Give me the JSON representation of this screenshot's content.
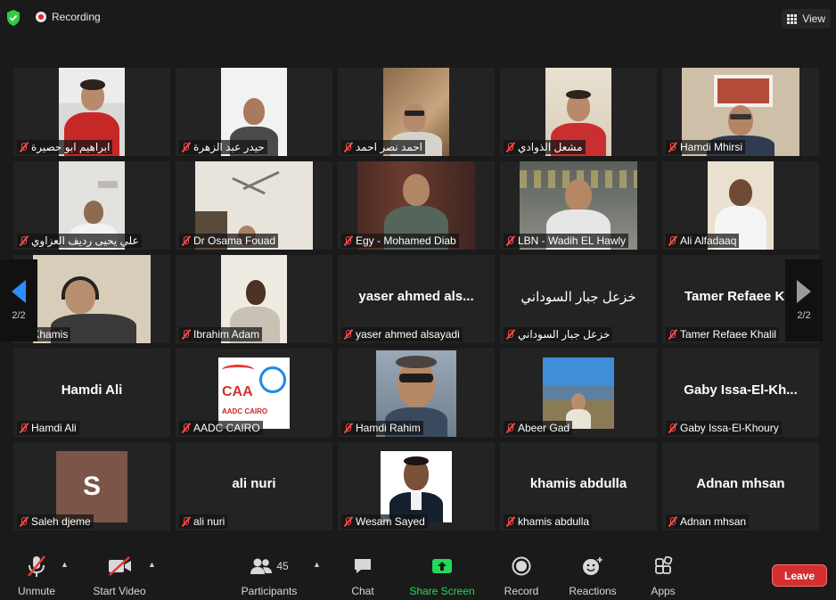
{
  "topbar": {
    "recording_label": "Recording",
    "view_label": "View"
  },
  "pagination": {
    "left_page": "2/2",
    "right_page": "2/2"
  },
  "tiles": [
    {
      "name": "ابراهيم ابو حصيرة",
      "big_name": "",
      "video": true
    },
    {
      "name": "حيدر عبد الزهرة",
      "big_name": "",
      "video": true
    },
    {
      "name": "احمد نصر احمد",
      "big_name": "",
      "video": true
    },
    {
      "name": "مشعل الذوادي",
      "big_name": "",
      "video": true
    },
    {
      "name": "Hamdi Mhirsi",
      "big_name": "",
      "video": true
    },
    {
      "name": "علي يحيى رديف العزاوي",
      "big_name": "",
      "video": true
    },
    {
      "name": "Dr Osama Fouad",
      "big_name": "",
      "video": true
    },
    {
      "name": "Egy - Mohamed Diab",
      "big_name": "",
      "video": true
    },
    {
      "name": "LBN - Wadih EL Hawly",
      "big_name": "",
      "video": true
    },
    {
      "name": "Ali Alfadaaq",
      "big_name": "",
      "video": true
    },
    {
      "name": "fic Khamis",
      "big_name": "",
      "video": true
    },
    {
      "name": "Ibrahim Adam",
      "big_name": "",
      "video": true
    },
    {
      "name": "yaser ahmed alsayadi",
      "big_name": "yaser ahmed als...",
      "video": false
    },
    {
      "name": "خزعل جبار السوداني",
      "big_name": "خزعل جبار السوداني",
      "video": false
    },
    {
      "name": "Tamer Refaee Khalil",
      "big_name": "Tamer Refaee K",
      "video": false
    },
    {
      "name": "Hamdi Ali",
      "big_name": "Hamdi Ali",
      "video": false
    },
    {
      "name": "AADC CAIRO",
      "big_name": "",
      "video": true
    },
    {
      "name": "Hamdi Rahim",
      "big_name": "",
      "video": true
    },
    {
      "name": "Abeer Gad",
      "big_name": "",
      "video": true
    },
    {
      "name": "Gaby Issa-El-Khoury",
      "big_name": "Gaby Issa-El-Kh...",
      "video": false
    },
    {
      "name": "Saleh djeme",
      "big_name": "",
      "video": true
    },
    {
      "name": "ali nuri",
      "big_name": "ali nuri",
      "video": false
    },
    {
      "name": "Wesam Sayed",
      "big_name": "",
      "video": true
    },
    {
      "name": "khamis abdulla",
      "big_name": "khamis abdulla",
      "video": false
    },
    {
      "name": "Adnan mhsan",
      "big_name": "Adnan mhsan",
      "video": false
    }
  ],
  "avatars": {
    "saleh_initial": "S",
    "aadc_logo_text": "CAA",
    "aadc_logo_sub": "AADC CAIRO"
  },
  "toolbar": {
    "unmute": "Unmute",
    "start_video": "Start Video",
    "participants": "Participants",
    "participants_count": "45",
    "chat": "Chat",
    "share_screen": "Share Screen",
    "record": "Record",
    "reactions": "Reactions",
    "apps": "Apps",
    "leave": "Leave"
  },
  "colors": {
    "share_green": "#23d959",
    "leave_red": "#d32f2f",
    "muted_red": "#ff4a4a"
  }
}
